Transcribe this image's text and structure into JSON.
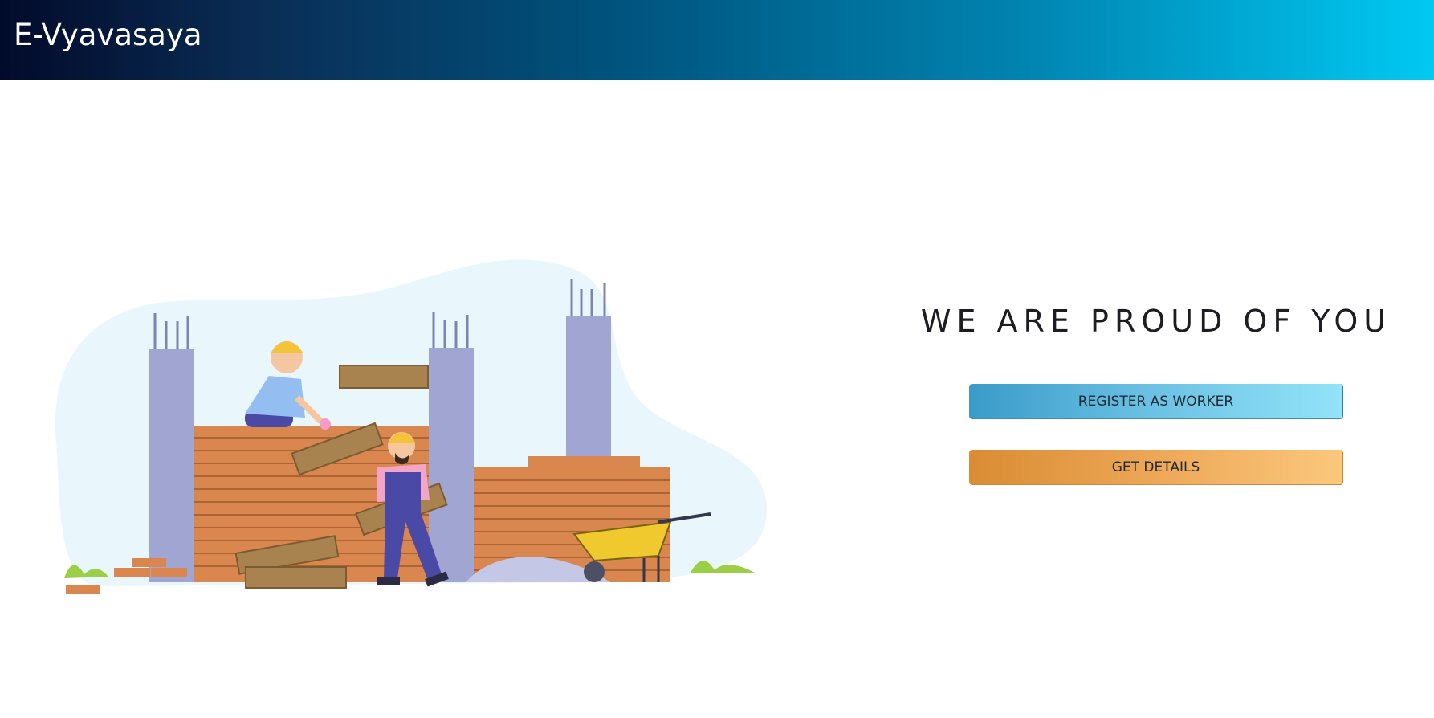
{
  "header": {
    "brand": "E-Vyavasaya"
  },
  "hero": {
    "headline": "WE ARE PROUD OF YOU",
    "illustration_icon": "construction-workers-illustration"
  },
  "actions": {
    "register_label": "REGISTER AS WORKER",
    "details_label": "GET DETAILS"
  },
  "colors": {
    "navbar_gradient_start": "#020a2a",
    "navbar_gradient_end": "#00c9f2",
    "register_button": "#6cc2e4",
    "details_button": "#eda757"
  }
}
